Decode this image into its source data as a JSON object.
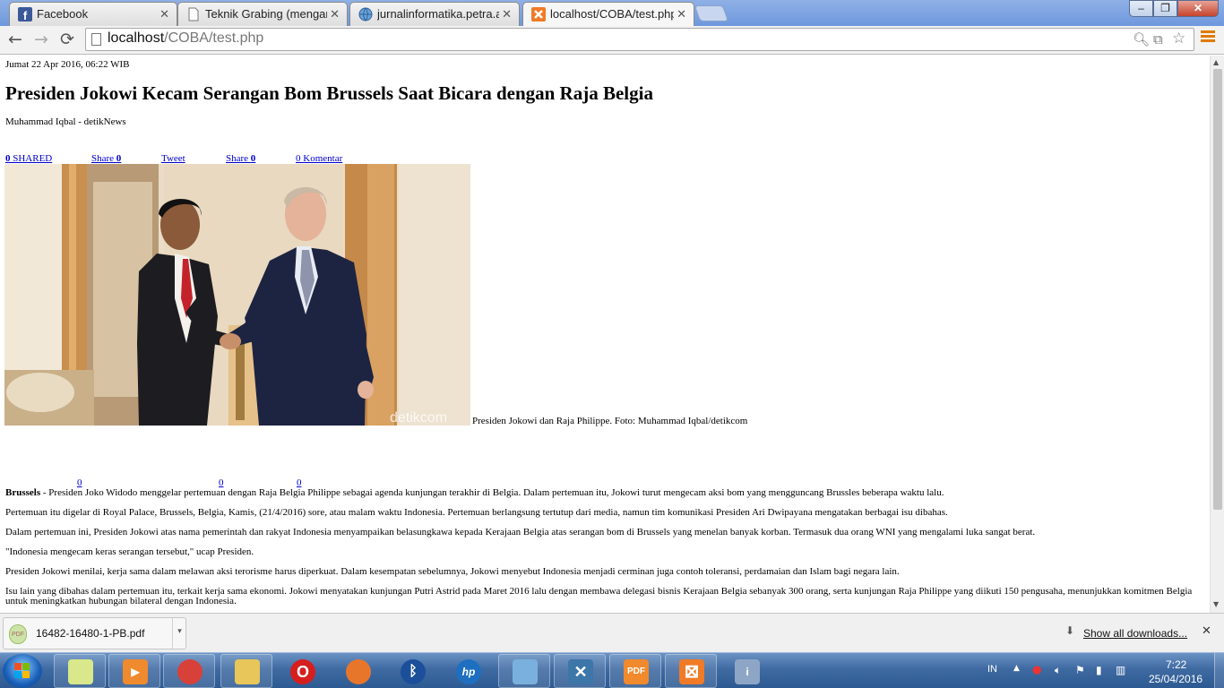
{
  "colors": {
    "tabstrip": "#6e98dd",
    "link": "#0000cc",
    "taskbar": "#3f6aa2",
    "chrome_menu": "#e07a00"
  },
  "browser": {
    "tabs": [
      {
        "title": "Facebook",
        "icon": "facebook-icon"
      },
      {
        "title": "Teknik Grabing (mengamb",
        "icon": "document-icon"
      },
      {
        "title": "jurnalinformatika.petra.ac.",
        "icon": "globe-icon"
      },
      {
        "title": "localhost/COBA/test.php",
        "icon": "xampp-icon"
      }
    ],
    "window_controls": {
      "minimize": "‒",
      "maximize": "❐",
      "close": "✕"
    },
    "nav": {
      "back": "←",
      "forward": "→",
      "reload": "⟳"
    },
    "url_host": "localhost",
    "url_path": "/COBA/test.php"
  },
  "article": {
    "date": "Jumat 22 Apr 2016, 06:22 WIB",
    "title": "Presiden Jokowi Kecam Serangan Bom Brussels Saat Bicara dengan Raja Belgia",
    "author": "Muhammad Iqbal - detikNews",
    "share_links": [
      {
        "count": "0",
        "label": " SHARED"
      },
      {
        "count": "0",
        "label": "Share "
      },
      {
        "count": "",
        "label": "Tweet"
      },
      {
        "count": "0",
        "label": "Share "
      },
      {
        "count": "",
        "label": "0 Komentar"
      }
    ],
    "photo_watermark": "detikcom",
    "caption": "Presiden Jokowi dan Raja Philippe. Foto: Muhammad Iqbal/detikcom",
    "zero_links": [
      "0",
      "0",
      "0"
    ],
    "lead_bold": "Brussels",
    "lead_text": " - Presiden Joko Widodo menggelar pertemuan dengan Raja Belgia Philippe sebagai agenda kunjungan terakhir di Belgia. Dalam pertemuan itu, Jokowi turut mengecam aksi bom yang mengguncang Brussles beberapa waktu lalu.",
    "paragraphs": [
      "Pertemuan itu digelar di Royal Palace, Brussels, Belgia, Kamis, (21/4/2016) sore, atau malam waktu Indonesia. Pertemuan berlangsung tertutup dari media, namun tim komunikasi Presiden Ari Dwipayana mengatakan berbagai isu dibahas.",
      "Dalam pertemuan ini, Presiden Jokowi atas nama pemerintah dan rakyat Indonesia menyampaikan belasungkawa kepada Kerajaan Belgia atas serangan bom di Brussels yang menelan banyak korban. Termasuk dua orang WNI yang mengalami luka sangat berat.",
      "\"Indonesia mengecam keras serangan tersebut,\" ucap Presiden.",
      "Presiden Jokowi menilai, kerja sama dalam melawan aksi terorisme harus diperkuat. Dalam kesempatan sebelumnya, Jokowi menyebut Indonesia menjadi cerminan juga contoh toleransi, perdamaian dan Islam bagi negara lain.",
      "Isu lain yang dibahas dalam pertemuan itu, terkait kerja sama ekonomi. Jokowi menyatakan kunjungan Putri Astrid pada Maret 2016 lalu dengan membawa delegasi bisnis Kerajaan Belgia sebanyak 300 orang, serta kunjungan Raja Philippe yang diikuti 150 pengusaha, menunjukkan komitmen Belgia untuk meningkatkan hubungan bilateral dengan Indonesia."
    ]
  },
  "downloads": {
    "file_name": "16482-16480-1-PB.pdf",
    "icon_text": "PDF",
    "show_all": "Show all downloads..."
  },
  "taskbar": {
    "apps": [
      {
        "name": "sticky-notes",
        "label": "",
        "color": "#d9e88a"
      },
      {
        "name": "media-player",
        "label": "▶",
        "color": "#ef8a2e"
      },
      {
        "name": "chrome",
        "label": "",
        "color": "#d8403a"
      },
      {
        "name": "explorer",
        "label": "",
        "color": "#e9c65a"
      },
      {
        "name": "opera",
        "label": "O",
        "color": "#d61e1e"
      },
      {
        "name": "firefox",
        "label": "",
        "color": "#e8762a"
      },
      {
        "name": "bluetooth",
        "label": "ᛒ",
        "color": "#1b4f9a"
      },
      {
        "name": "hp",
        "label": "hp",
        "color": "#1e6fc0"
      },
      {
        "name": "control-panel",
        "label": "",
        "color": "#7ab0de"
      },
      {
        "name": "tools",
        "label": "✕",
        "color": "#3d76a8"
      },
      {
        "name": "pdf-app",
        "label": "PDF",
        "color": "#f08a2c"
      },
      {
        "name": "xampp",
        "label": "⊠",
        "color": "#f07a26"
      },
      {
        "name": "printer",
        "label": "i",
        "color": "#8ea6c6"
      }
    ],
    "tray_lang": "IN",
    "time": "7:22",
    "date": "25/04/2016"
  }
}
